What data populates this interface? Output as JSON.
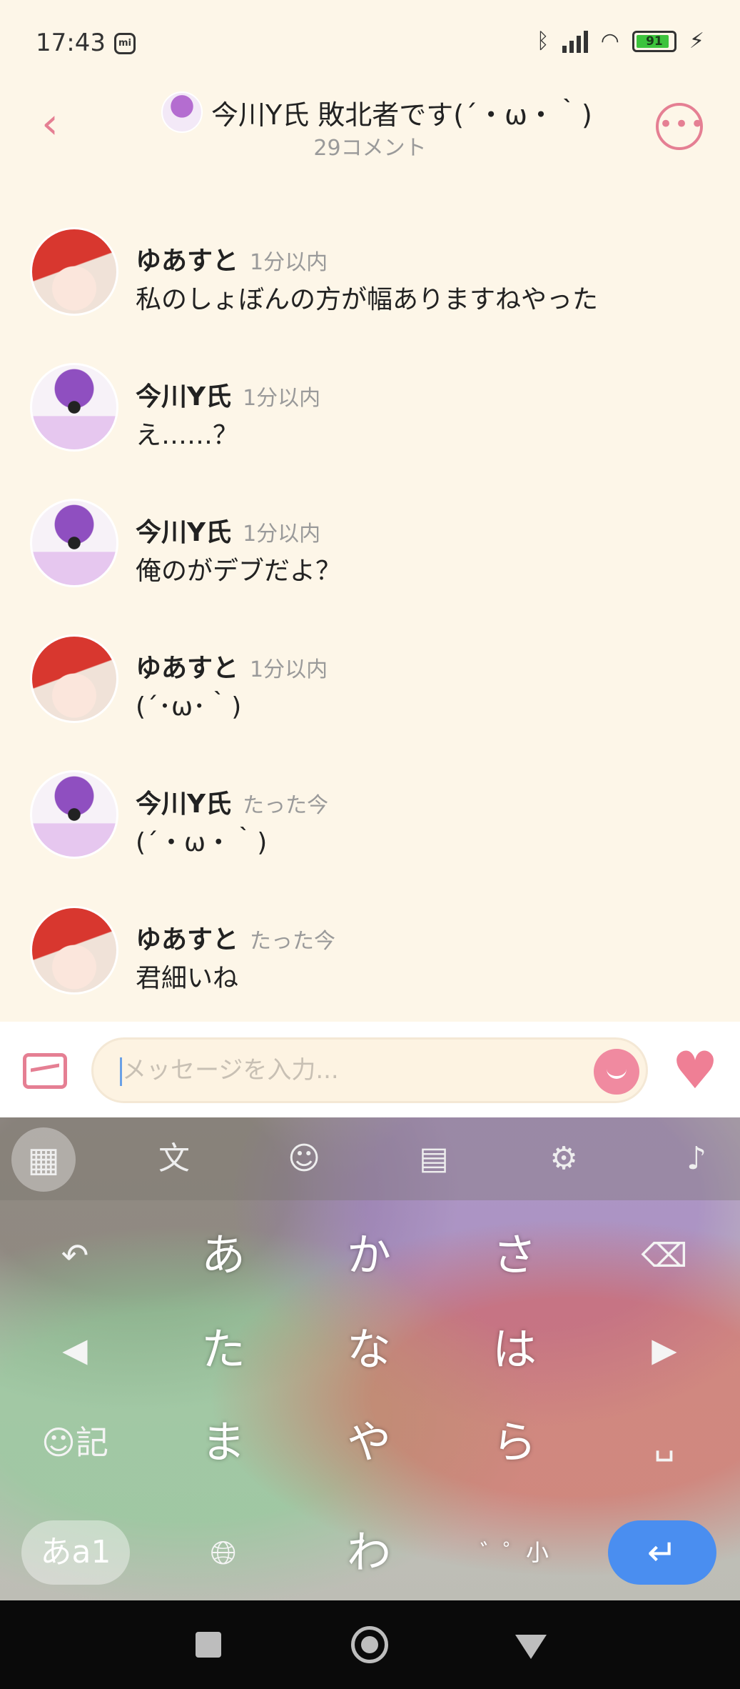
{
  "status_bar": {
    "time": "17:43",
    "mi_label": "mi",
    "battery_level": "91",
    "battery_fraction": 0.91,
    "icons": [
      "bluetooth-icon",
      "signal-icon",
      "wifi-icon",
      "battery-icon",
      "charging-icon"
    ]
  },
  "header": {
    "title": "今川Y氏 敗北者です(´・ω・｀)",
    "subtitle": "29コメント",
    "back_icon": "‹",
    "more_icon": "•••"
  },
  "comments": [
    {
      "name": "ゆあすと",
      "time": "1分以内",
      "text": "私のしょぼんの方が幅ありますねやった",
      "avatar": "red"
    },
    {
      "name": "今川Y氏",
      "time": "1分以内",
      "text": "え……？",
      "avatar": "purple"
    },
    {
      "name": "今川Y氏",
      "time": "1分以内",
      "text": "俺のがデブだよ？",
      "avatar": "purple"
    },
    {
      "name": "ゆあすと",
      "time": "1分以内",
      "text": "(´･ω･｀)",
      "avatar": "red"
    },
    {
      "name": "今川Y氏",
      "time": "たった今",
      "text": "(´・ω・｀)",
      "avatar": "purple"
    },
    {
      "name": "ゆあすと",
      "time": "たった今",
      "text": "君細いね",
      "avatar": "red"
    }
  ],
  "input": {
    "placeholder": "メッセージを入力..."
  },
  "keyboard": {
    "toolbar": [
      "grid-icon",
      "translate-icon",
      "sticker-icon",
      "clipboard-icon",
      "settings-icon",
      "mic-icon"
    ],
    "keys": {
      "a": "あ",
      "ka": "か",
      "sa": "さ",
      "ta": "た",
      "na": "な",
      "ha": "は",
      "ma": "ま",
      "ya": "や",
      "ra": "ら",
      "wa": "わ",
      "punct": "゛゜小",
      "kana": "あa1"
    },
    "side": {
      "undo": "↶",
      "left": "◀",
      "right": "▶",
      "delete": "⌫",
      "emoji": "☺記",
      "space": "␣",
      "globe": "🌐︎",
      "enter": "↵"
    }
  }
}
